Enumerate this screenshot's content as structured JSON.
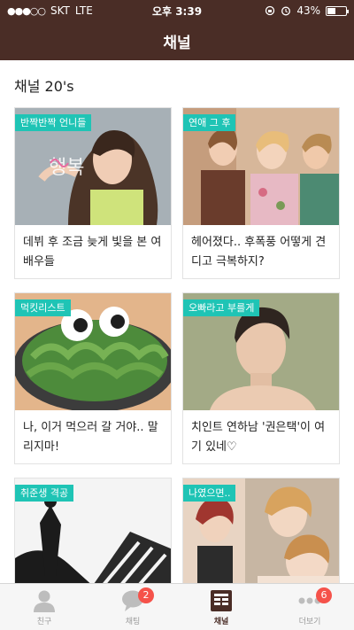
{
  "status_bar": {
    "signal": "●●●○○",
    "carrier": "SKT",
    "network": "LTE",
    "time": "오후 3:39",
    "battery_text": "43%",
    "battery_level": 0.43
  },
  "header": {
    "title": "채널"
  },
  "section": {
    "title": "채널 20's"
  },
  "cards": [
    {
      "tag": "반짝반짝 언니들",
      "title": "데뷔 후 조금 늦게 빛을 본 여배우들"
    },
    {
      "tag": "연애 그 후",
      "title": "헤어졌다.. 후폭풍 어떻게 견디고 극복하지?"
    },
    {
      "tag": "먹킷리스트",
      "title": "나, 이거 먹으러 갈 거야.. 말리지마!"
    },
    {
      "tag": "오빠라고 부를게",
      "title": "치인트 연하남 '권은택'이 여기 있네♡"
    },
    {
      "tag": "취준생 격공",
      "title": ""
    },
    {
      "tag": "나였으면..",
      "title": ""
    }
  ],
  "card_image_text": "행복",
  "tabs": [
    {
      "label": "친구",
      "icon": "person-icon",
      "badge": ""
    },
    {
      "label": "채팅",
      "icon": "chat-bubble-icon",
      "badge": "2"
    },
    {
      "label": "채널",
      "icon": "channel-icon",
      "badge": ""
    },
    {
      "label": "더보기",
      "icon": "more-dots-icon",
      "badge": "6"
    }
  ],
  "colors": {
    "header_bg": "#4a2d26",
    "tag_bg": "#1fc4b5",
    "badge_bg": "#f5524a"
  }
}
